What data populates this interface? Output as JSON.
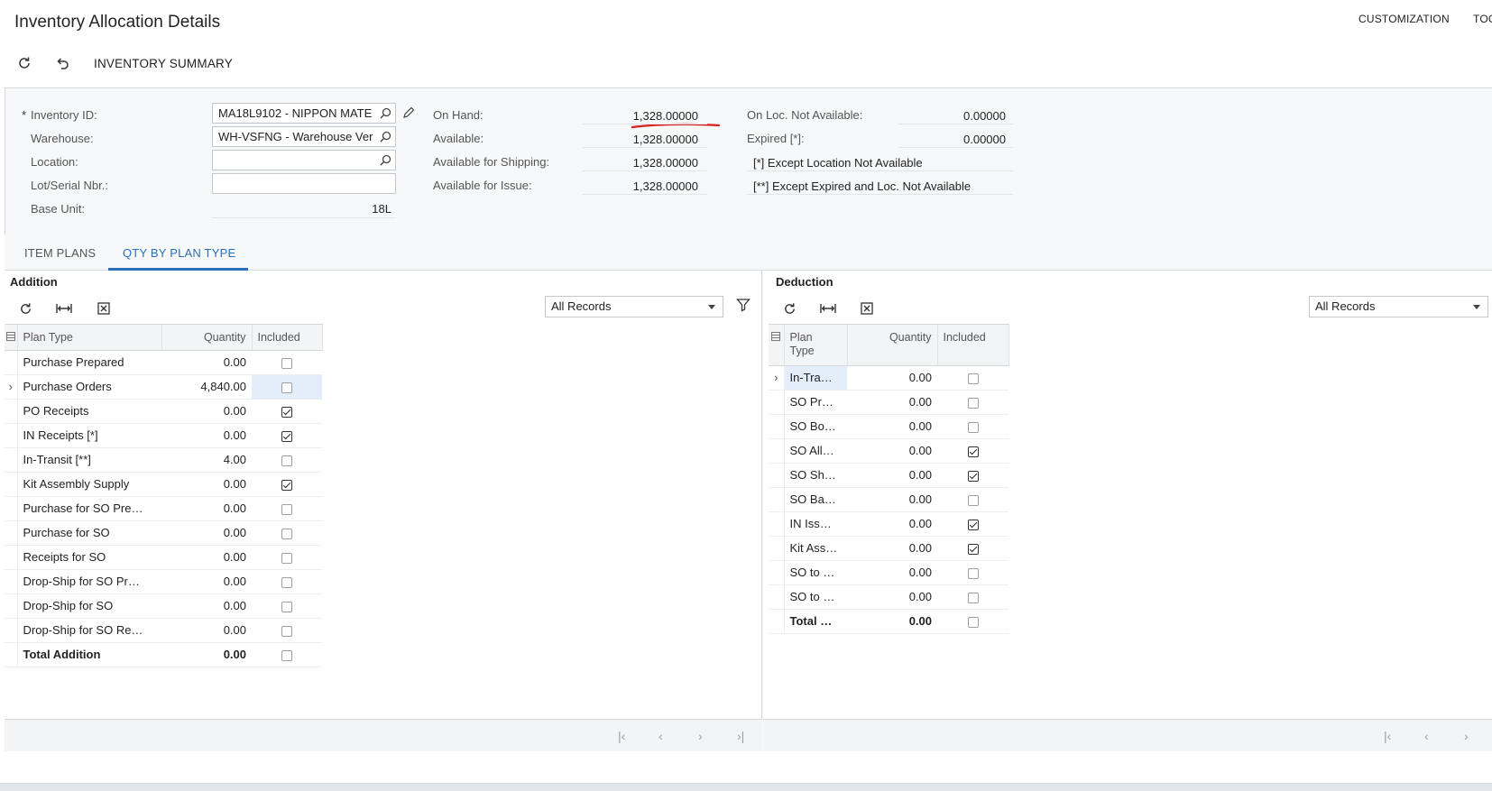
{
  "header": {
    "title": "Inventory Allocation Details",
    "menu": [
      "CUSTOMIZATION",
      "TOO"
    ],
    "toolbar": {
      "summary_label": "INVENTORY SUMMARY"
    }
  },
  "form": {
    "inventory_id": {
      "label": "Inventory ID:",
      "value": "MA18L9102 - NIPPON MATE",
      "required_mark": "*"
    },
    "warehouse": {
      "label": "Warehouse:",
      "value": "WH-VSFNG - Warehouse Ver"
    },
    "location": {
      "label": "Location:",
      "value": ""
    },
    "lot_serial": {
      "label": "Lot/Serial Nbr.:",
      "value": ""
    },
    "base_unit": {
      "label": "Base Unit:",
      "value": "18L"
    },
    "on_hand": {
      "label": "On Hand:",
      "value": "1,328.00000"
    },
    "available": {
      "label": "Available:",
      "value": "1,328.00000"
    },
    "available_shipping": {
      "label": "Available for Shipping:",
      "value": "1,328.00000"
    },
    "available_issue": {
      "label": "Available for Issue:",
      "value": "1,328.00000"
    },
    "on_loc_not_available": {
      "label": "On Loc. Not Available:",
      "value": "0.00000"
    },
    "expired": {
      "label": "Expired [*]:",
      "value": "0.00000"
    },
    "note1": "[*]  Except Location Not Available",
    "note2": "[**] Except Expired and  Loc. Not Available",
    "annotation_color": "#d92020"
  },
  "tabs": [
    {
      "label": "ITEM PLANS",
      "active": false
    },
    {
      "label": "QTY BY PLAN TYPE",
      "active": true
    }
  ],
  "addition": {
    "title": "Addition",
    "filter": "All Records",
    "columns": {
      "plan_type": "Plan Type",
      "quantity": "Quantity",
      "included": "Included"
    },
    "rows": [
      {
        "plan_type": "Purchase Prepared",
        "quantity": "0.00",
        "included": false
      },
      {
        "plan_type": "Purchase Orders",
        "quantity": "4,840.00",
        "included": false
      },
      {
        "plan_type": "PO Receipts",
        "quantity": "0.00",
        "included": true
      },
      {
        "plan_type": "IN Receipts [*]",
        "quantity": "0.00",
        "included": true
      },
      {
        "plan_type": "In-Transit [**]",
        "quantity": "4.00",
        "included": false
      },
      {
        "plan_type": "Kit Assembly Supply",
        "quantity": "0.00",
        "included": true
      },
      {
        "plan_type": "Purchase for SO Pre…",
        "quantity": "0.00",
        "included": false
      },
      {
        "plan_type": "Purchase for SO",
        "quantity": "0.00",
        "included": false
      },
      {
        "plan_type": "Receipts for SO",
        "quantity": "0.00",
        "included": false
      },
      {
        "plan_type": "Drop-Ship for SO Pr…",
        "quantity": "0.00",
        "included": false
      },
      {
        "plan_type": "Drop-Ship for SO",
        "quantity": "0.00",
        "included": false
      },
      {
        "plan_type": "Drop-Ship for SO Re…",
        "quantity": "0.00",
        "included": false
      },
      {
        "plan_type": "Total Addition",
        "quantity": "0.00",
        "included": false
      }
    ]
  },
  "deduction": {
    "title": "Deduction",
    "filter": "All Records",
    "columns": {
      "plan_type_1": "Plan",
      "plan_type_2": "Type",
      "quantity": "Quantity",
      "included": "Included"
    },
    "rows": [
      {
        "plan_type": "In-Tra…",
        "quantity": "0.00",
        "included": false
      },
      {
        "plan_type": "SO Pr…",
        "quantity": "0.00",
        "included": false
      },
      {
        "plan_type": "SO Bo…",
        "quantity": "0.00",
        "included": false
      },
      {
        "plan_type": "SO All…",
        "quantity": "0.00",
        "included": true
      },
      {
        "plan_type": "SO Sh…",
        "quantity": "0.00",
        "included": true
      },
      {
        "plan_type": "SO Ba…",
        "quantity": "0.00",
        "included": false
      },
      {
        "plan_type": "IN Iss…",
        "quantity": "0.00",
        "included": true
      },
      {
        "plan_type": "Kit Ass…",
        "quantity": "0.00",
        "included": true
      },
      {
        "plan_type": "SO to …",
        "quantity": "0.00",
        "included": false
      },
      {
        "plan_type": "SO to …",
        "quantity": "0.00",
        "included": false
      },
      {
        "plan_type": "Total …",
        "quantity": "0.00",
        "included": false
      }
    ]
  }
}
